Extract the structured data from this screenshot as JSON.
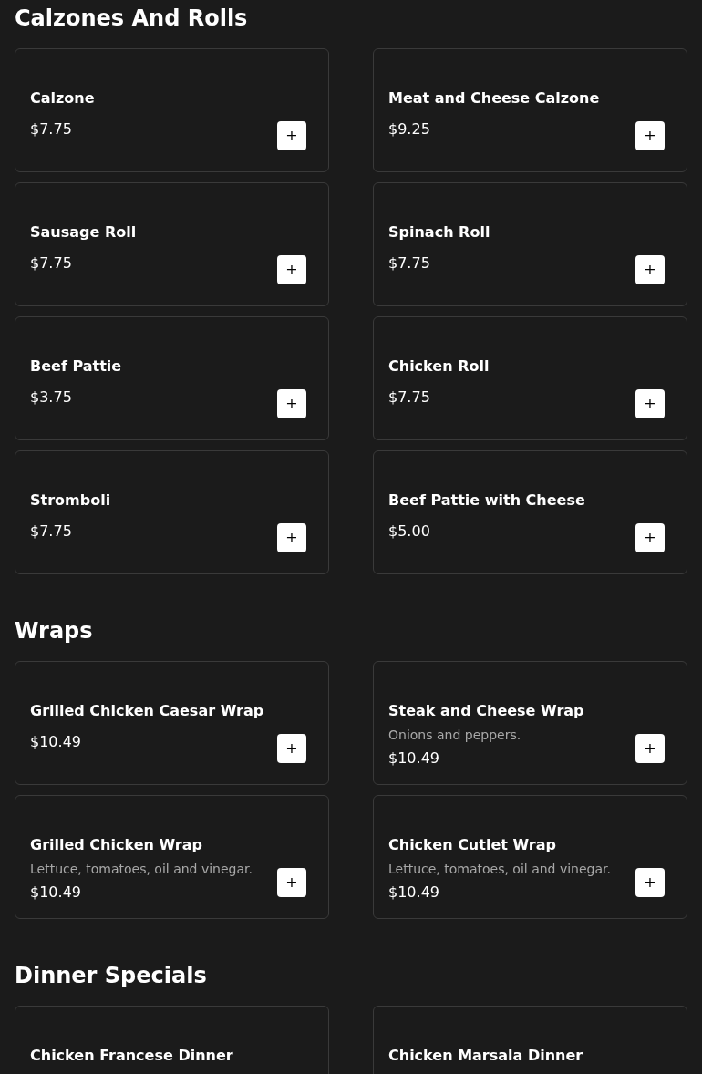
{
  "sections": [
    {
      "title": "Calzones And Rolls",
      "items": [
        {
          "name": "Calzone",
          "price": "$7.75",
          "button": "+"
        },
        {
          "name": "Meat and Cheese Calzone",
          "price": "$9.25",
          "button": "+"
        },
        {
          "name": "Sausage Roll",
          "price": "$7.75",
          "button": "+"
        },
        {
          "name": "Spinach Roll",
          "price": "$7.75",
          "button": "+"
        },
        {
          "name": "Beef Pattie",
          "price": "$3.75",
          "button": "+"
        },
        {
          "name": "Chicken Roll",
          "price": "$7.75",
          "button": "+"
        },
        {
          "name": "Stromboli",
          "price": "$7.75",
          "button": "+"
        },
        {
          "name": "Beef Pattie with Cheese",
          "price": "$5.00",
          "button": "+"
        }
      ]
    },
    {
      "title": "Wraps",
      "items": [
        {
          "name": "Grilled Chicken Caesar Wrap",
          "price": "$10.49",
          "button": "+"
        },
        {
          "name": "Steak and Cheese Wrap",
          "description": "Onions and peppers.",
          "price": "$10.49",
          "button": "+"
        },
        {
          "name": "Grilled Chicken Wrap",
          "description": "Lettuce, tomatoes, oil and vinegar.",
          "price": "$10.49",
          "button": "+"
        },
        {
          "name": "Chicken Cutlet Wrap",
          "description": "Lettuce, tomatoes, oil and vinegar.",
          "price": "$10.49",
          "button": "+"
        }
      ]
    },
    {
      "title": "Dinner Specials",
      "items": [
        {
          "name": "Chicken Francese Dinner"
        },
        {
          "name": "Chicken Marsala Dinner"
        }
      ]
    }
  ]
}
